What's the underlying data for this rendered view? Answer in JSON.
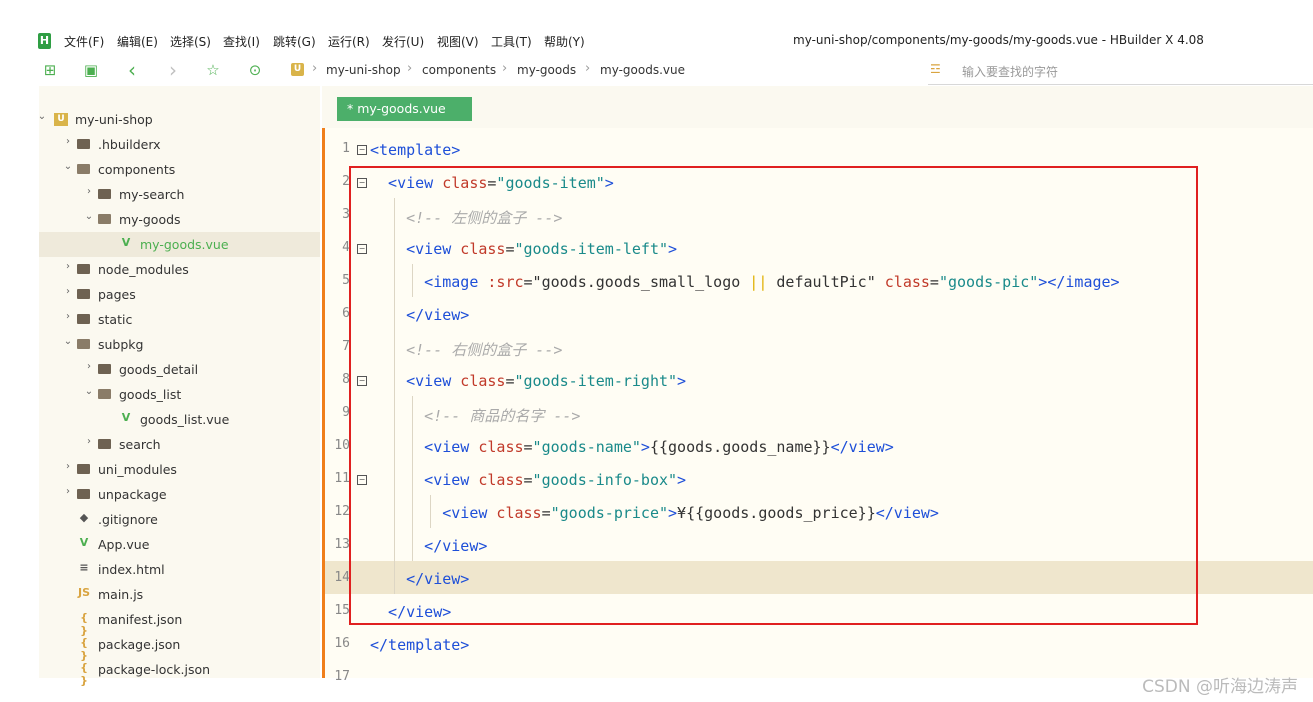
{
  "app": {
    "logo": "H",
    "window_title": "my-uni-shop/components/my-goods/my-goods.vue - HBuilder X 4.08"
  },
  "menu": [
    "文件(F)",
    "编辑(E)",
    "选择(S)",
    "查找(I)",
    "跳转(G)",
    "运行(R)",
    "发行(U)",
    "视图(V)",
    "工具(T)",
    "帮助(Y)"
  ],
  "toolbar": {
    "icons": [
      "new-file-icon",
      "save-icon",
      "back-icon",
      "forward-icon",
      "star-icon",
      "run-icon"
    ]
  },
  "breadcrumb": {
    "badge": "U",
    "items": [
      "my-uni-shop",
      "components",
      "my-goods",
      "my-goods.vue"
    ]
  },
  "search": {
    "placeholder": "输入要查找的字符"
  },
  "tree": [
    {
      "label": "my-uni-shop",
      "indent": 0,
      "kind": "project",
      "expanded": true
    },
    {
      "label": ".hbuilderx",
      "indent": 1,
      "kind": "folder",
      "expanded": false
    },
    {
      "label": "components",
      "indent": 1,
      "kind": "folder",
      "expanded": true
    },
    {
      "label": "my-search",
      "indent": 2,
      "kind": "folder",
      "expanded": false
    },
    {
      "label": "my-goods",
      "indent": 2,
      "kind": "folder",
      "expanded": true
    },
    {
      "label": "my-goods.vue",
      "indent": 3,
      "kind": "vue",
      "selected": true
    },
    {
      "label": "node_modules",
      "indent": 1,
      "kind": "folder",
      "expanded": false
    },
    {
      "label": "pages",
      "indent": 1,
      "kind": "folder",
      "expanded": false
    },
    {
      "label": "static",
      "indent": 1,
      "kind": "folder",
      "expanded": false
    },
    {
      "label": "subpkg",
      "indent": 1,
      "kind": "folder",
      "expanded": true
    },
    {
      "label": "goods_detail",
      "indent": 2,
      "kind": "folder",
      "expanded": false
    },
    {
      "label": "goods_list",
      "indent": 2,
      "kind": "folder",
      "expanded": true
    },
    {
      "label": "goods_list.vue",
      "indent": 3,
      "kind": "vue"
    },
    {
      "label": "search",
      "indent": 2,
      "kind": "folder",
      "expanded": false
    },
    {
      "label": "uni_modules",
      "indent": 1,
      "kind": "folder",
      "expanded": false
    },
    {
      "label": "unpackage",
      "indent": 1,
      "kind": "folder",
      "expanded": false
    },
    {
      "label": ".gitignore",
      "indent": 1,
      "kind": "git"
    },
    {
      "label": "App.vue",
      "indent": 1,
      "kind": "vue"
    },
    {
      "label": "index.html",
      "indent": 1,
      "kind": "html"
    },
    {
      "label": "main.js",
      "indent": 1,
      "kind": "js"
    },
    {
      "label": "manifest.json",
      "indent": 1,
      "kind": "json"
    },
    {
      "label": "package.json",
      "indent": 1,
      "kind": "json"
    },
    {
      "label": "package-lock.json",
      "indent": 1,
      "kind": "json"
    }
  ],
  "tab": {
    "label": "* my-goods.vue"
  },
  "code": [
    {
      "n": "1",
      "fold": true,
      "indent": 0,
      "parts": [
        [
          "tag",
          "<template>"
        ]
      ]
    },
    {
      "n": "2",
      "fold": true,
      "indent": 1,
      "parts": [
        [
          "tag",
          "<view "
        ],
        [
          "attr",
          "class"
        ],
        [
          "txt",
          "="
        ],
        [
          "str",
          "\"goods-item\""
        ],
        [
          "tag",
          ">"
        ]
      ]
    },
    {
      "n": "3",
      "fold": false,
      "indent": 2,
      "parts": [
        [
          "cmt",
          "<!-- 左侧的盒子 -->"
        ]
      ]
    },
    {
      "n": "4",
      "fold": true,
      "indent": 2,
      "parts": [
        [
          "tag",
          "<view "
        ],
        [
          "attr",
          "class"
        ],
        [
          "txt",
          "="
        ],
        [
          "str",
          "\"goods-item-left\""
        ],
        [
          "tag",
          ">"
        ]
      ]
    },
    {
      "n": "5",
      "fold": false,
      "indent": 3,
      "parts": [
        [
          "tag",
          "<image "
        ],
        [
          "attr",
          ":src"
        ],
        [
          "txt",
          "=\"goods.goods_small_logo "
        ],
        [
          "pipe",
          "||"
        ],
        [
          "txt",
          " defaultPic\" "
        ],
        [
          "attr",
          "class"
        ],
        [
          "txt",
          "="
        ],
        [
          "str",
          "\"goods-pic\""
        ],
        [
          "tag",
          "></image>"
        ]
      ]
    },
    {
      "n": "6",
      "fold": false,
      "indent": 2,
      "parts": [
        [
          "tag",
          "</view>"
        ]
      ]
    },
    {
      "n": "7",
      "fold": false,
      "indent": 2,
      "parts": [
        [
          "cmt",
          "<!-- 右侧的盒子 -->"
        ]
      ]
    },
    {
      "n": "8",
      "fold": true,
      "indent": 2,
      "parts": [
        [
          "tag",
          "<view "
        ],
        [
          "attr",
          "class"
        ],
        [
          "txt",
          "="
        ],
        [
          "str",
          "\"goods-item-right\""
        ],
        [
          "tag",
          ">"
        ]
      ]
    },
    {
      "n": "9",
      "fold": false,
      "indent": 3,
      "parts": [
        [
          "cmt",
          "<!-- 商品的名字 -->"
        ]
      ]
    },
    {
      "n": "10",
      "fold": false,
      "indent": 3,
      "parts": [
        [
          "tag",
          "<view "
        ],
        [
          "attr",
          "class"
        ],
        [
          "txt",
          "="
        ],
        [
          "str",
          "\"goods-name\""
        ],
        [
          "tag",
          ">"
        ],
        [
          "txt",
          "{{goods.goods_name}}"
        ],
        [
          "tag",
          "</view>"
        ]
      ]
    },
    {
      "n": "11",
      "fold": true,
      "indent": 3,
      "parts": [
        [
          "tag",
          "<view "
        ],
        [
          "attr",
          "class"
        ],
        [
          "txt",
          "="
        ],
        [
          "str",
          "\"goods-info-box\""
        ],
        [
          "tag",
          ">"
        ]
      ]
    },
    {
      "n": "12",
      "fold": false,
      "indent": 4,
      "parts": [
        [
          "tag",
          "<view "
        ],
        [
          "attr",
          "class"
        ],
        [
          "txt",
          "="
        ],
        [
          "str",
          "\"goods-price\""
        ],
        [
          "tag",
          ">"
        ],
        [
          "txt",
          "¥{{goods.goods_price}}"
        ],
        [
          "tag",
          "</view>"
        ]
      ]
    },
    {
      "n": "13",
      "fold": false,
      "indent": 3,
      "parts": [
        [
          "tag",
          "</view>"
        ]
      ]
    },
    {
      "n": "14",
      "fold": false,
      "indent": 2,
      "current": true,
      "parts": [
        [
          "tag",
          "</view>"
        ]
      ]
    },
    {
      "n": "15",
      "fold": false,
      "indent": 1,
      "parts": [
        [
          "tag",
          "</view>"
        ]
      ]
    },
    {
      "n": "16",
      "fold": false,
      "indent": 0,
      "parts": [
        [
          "tag",
          "</template>"
        ]
      ]
    },
    {
      "n": "17",
      "fold": false,
      "indent": 0,
      "parts": []
    }
  ],
  "colors": {
    "accent": "#4caf6a",
    "highlight_box": "#e02020",
    "modified_bar": "#f07f1c"
  },
  "watermark": "CSDN @听海边涛声"
}
